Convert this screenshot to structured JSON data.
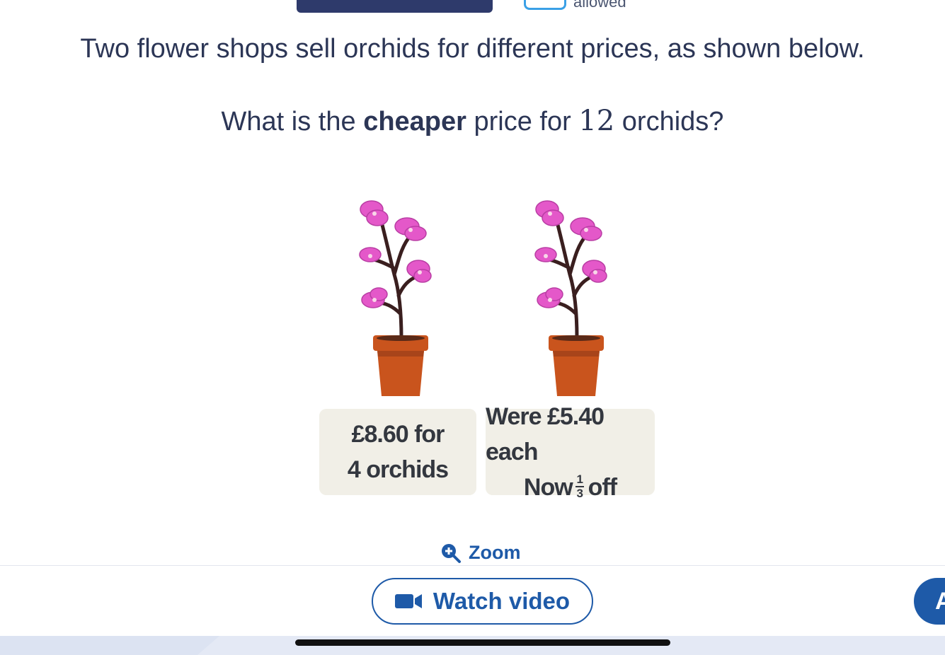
{
  "header": {
    "calculator_note": "allowed"
  },
  "question": {
    "line1": "Two flower shops sell orchids for different prices, as shown below.",
    "line2_before": "What is the ",
    "line2_bold": "cheaper",
    "line2_mid": " price for ",
    "line2_number": "12",
    "line2_after": " orchids?"
  },
  "cards": [
    {
      "line1": "£8.60 for",
      "line2": "4 orchids"
    },
    {
      "line1": "Were £5.40 each",
      "line2_prefix": "Now",
      "frac_num": "1",
      "frac_den": "3",
      "line2_suffix": "off"
    }
  ],
  "zoom_label": "Zoom",
  "watch_video_label": "Watch video",
  "answer_button_label": "A",
  "colors": {
    "accent": "#1e5aa8",
    "text": "#2c3656",
    "card": "#f1efe7",
    "pot": "#c9541d",
    "petal": "#e458c9"
  }
}
